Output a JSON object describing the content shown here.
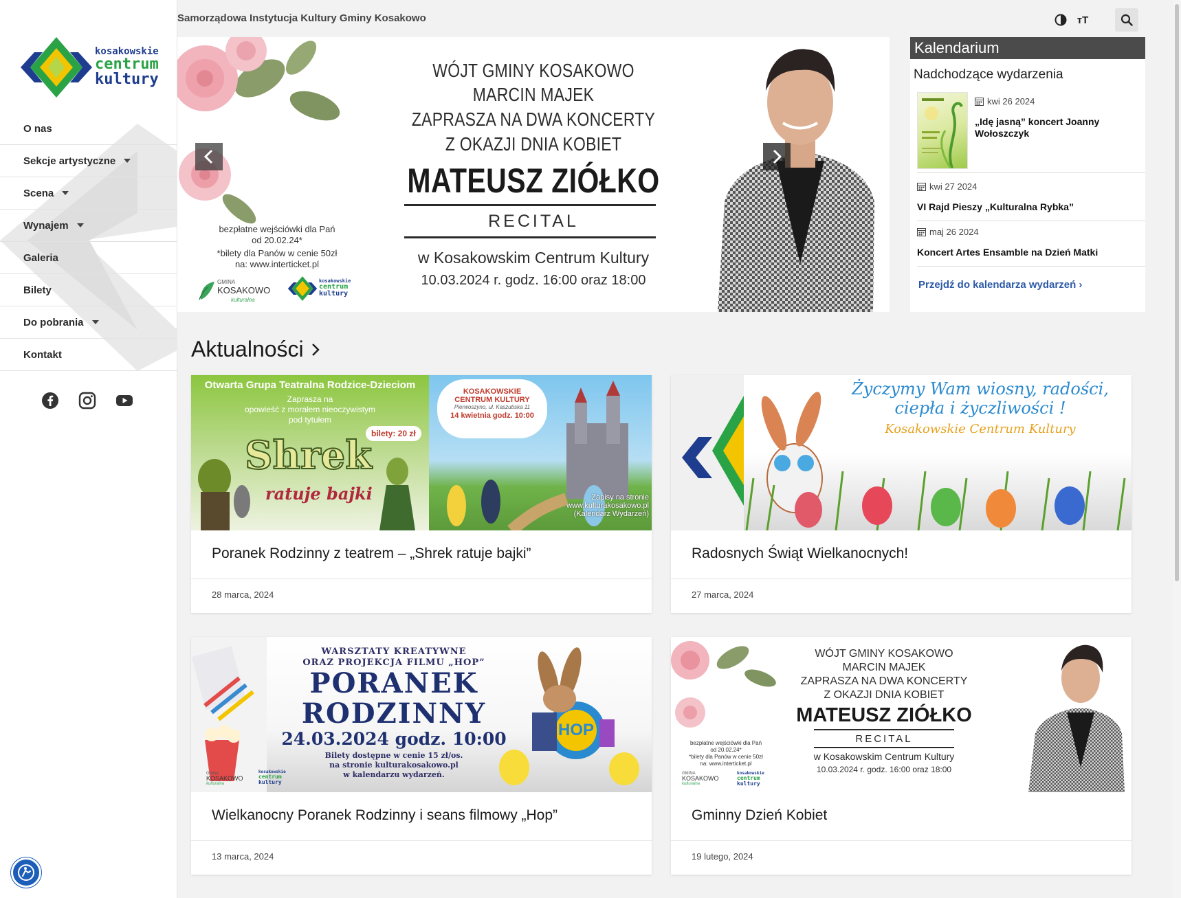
{
  "site": {
    "institution": "Samorządowa Instytucja Kultury Gminy Kosakowo",
    "logo": {
      "line1": "kosakowskie",
      "line2": "centrum",
      "line3": "kultury"
    }
  },
  "nav": [
    {
      "label": "O nas",
      "dropdown": false
    },
    {
      "label": "Sekcje artystyczne",
      "dropdown": true
    },
    {
      "label": "Scena",
      "dropdown": true
    },
    {
      "label": "Wynajem",
      "dropdown": true
    },
    {
      "label": "Galeria",
      "dropdown": false
    },
    {
      "label": "Bilety",
      "dropdown": false
    },
    {
      "label": "Do pobrania",
      "dropdown": true
    },
    {
      "label": "Kontakt",
      "dropdown": false
    }
  ],
  "social": [
    "facebook-icon",
    "instagram-icon",
    "youtube-icon"
  ],
  "toolbar": {
    "textsize_glyph": "ᴛT"
  },
  "slider": {
    "line1": "WÓJT GMINY KOSAKOWO",
    "line2": "MARCIN MAJEK",
    "line3": "ZAPRASZA NA DWA KONCERTY",
    "line4": "Z OKAZJI DNIA KOBIET",
    "name": "MATEUSZ ZIÓŁKO",
    "recital": "RECITAL",
    "venue": "w Kosakowskim Centrum Kultury",
    "date": "10.03.2024 r. godz. 16:00 oraz 18:00",
    "ticket1": "bezpłatne wejściówki dla Pań",
    "ticket2": "od 20.02.24*",
    "ticket3": "*bilety dla Panów w cenie 50zł",
    "ticket4": "na: www.interticket.pl",
    "gmina_small": "GMINA",
    "gmina": "KOSAKOWO",
    "gmina_tag": "kulturalna"
  },
  "calendar": {
    "title": "Kalendarium",
    "subtitle": "Nadchodzące wydarzenia",
    "events": [
      {
        "date": "kwi 26 2024",
        "title": "„Idę jasną” koncert Joanny Wołoszczyk"
      },
      {
        "date": "kwi 27 2024",
        "title": "VI Rajd Pieszy „Kulturalna Rybka”"
      },
      {
        "date": "maj 26 2024",
        "title": "Koncert Artes Ensamble na Dzień Matki"
      }
    ],
    "link": "Przejdź do kalendarza wydarzeń"
  },
  "news": {
    "heading": "Aktualności",
    "items": [
      {
        "title": "Poranek Rodzinny z teatrem – „Shrek ratuje bajki”",
        "date": "28 marca, 2024"
      },
      {
        "title": "Radosnych Świąt Wielkanocnych!",
        "date": "27 marca, 2024"
      },
      {
        "title": "Wielkanocny Poranek Rodzinny i seans filmowy „Hop”",
        "date": "13 marca, 2024"
      },
      {
        "title": "Gminny Dzień Kobiet",
        "date": "19 lutego, 2024"
      }
    ]
  },
  "banners": {
    "shrek": {
      "top": "Otwarta Grupa Teatralna Rodzice-Dzieciom",
      "sub1": "Zaprasza na",
      "sub2": "opowieść z morałem nieoczywistym",
      "sub3": "pod tytułem",
      "title": "Shrek",
      "subtitle": "ratuje bajki",
      "price": "bilety: 20 zł",
      "cloud1": "KOSAKOWSKIE",
      "cloud2": "CENTRUM KULTURY",
      "cloud3": "Pierwoszyno, ul. Kaszubska 11",
      "cloud4": "14 kwietnia godz. 10:00",
      "reg1": "Zapisy na stronie",
      "reg2": "www.kulturakosakowo.pl",
      "reg3": "(Kalendarz Wydarzeń)"
    },
    "easter": {
      "line1": "Życzymy Wam wiosny, radości,",
      "line2": "ciepła i życzliwości !",
      "line3": "Kosakowskie Centrum Kultury"
    },
    "hop": {
      "top1": "WARSZTATY KREATYWNE",
      "top2": "ORAZ PROJEKCJA FILMU „HOP”",
      "big1": "PORANEK",
      "big2": "RODZINNY",
      "date": "24.03.2024 godz. 10:00",
      "info1": "Bilety dostępne w cenie 15 zł/os.",
      "info2": "na stronie kulturakosakowo.pl",
      "info3": "w kalendarzu wydarzeń.",
      "hop": "HOP",
      "gmina_small": "Gmina",
      "gmina": "KOSAKOWO",
      "gmina_tag": "kulturalna",
      "logo1": "kosakowskie",
      "logo2": "centrum",
      "logo3": "kultury"
    }
  },
  "colors": {
    "accent_blue": "#2d5aa8",
    "logo_green": "#2aa246",
    "logo_blue": "#1e3d8f",
    "logo_yellow": "#f2c500",
    "cal_head": "#4b4b4b"
  }
}
